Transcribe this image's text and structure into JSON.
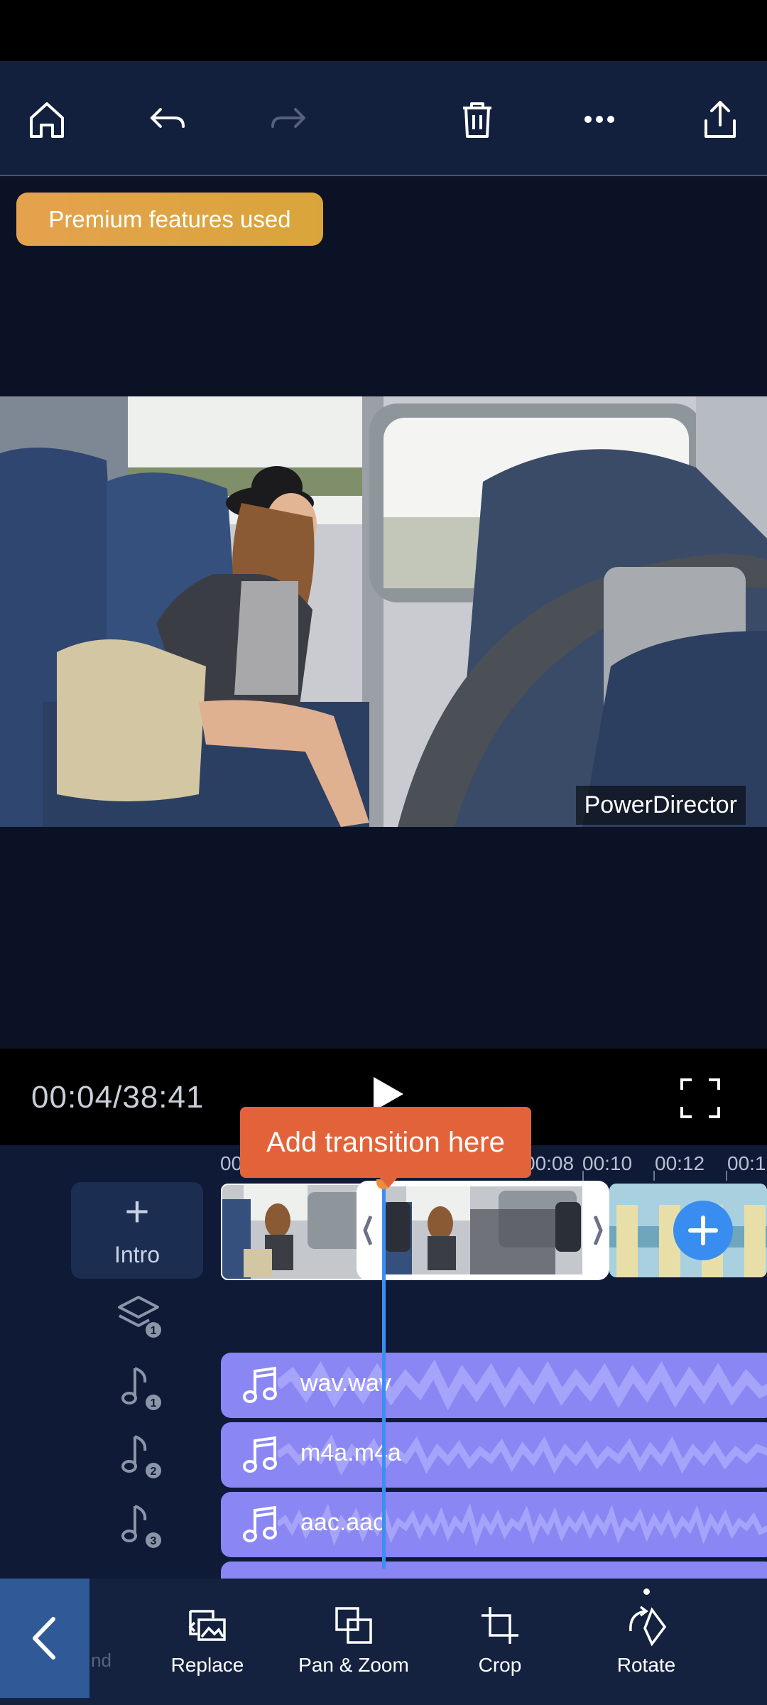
{
  "toolbar": {
    "home_icon": "home-icon",
    "undo_icon": "undo-icon",
    "redo_icon": "redo-icon",
    "delete_icon": "trash-icon",
    "more_icon": "more-icon",
    "share_icon": "share-icon"
  },
  "premium_badge": "Premium features used",
  "preview": {
    "watermark": "PowerDirector"
  },
  "playback": {
    "timecode": "00:04/38:41"
  },
  "timeline": {
    "ruler": [
      "00",
      "00:08",
      "00:10",
      "00:12",
      "00:1"
    ],
    "intro_label": "Intro",
    "tooltip": "Add transition here",
    "audio_tracks": [
      {
        "name": "wav.wav",
        "badge": "1"
      },
      {
        "name": "m4a.m4a",
        "badge": "2"
      },
      {
        "name": "aac.aac",
        "badge": "3"
      }
    ],
    "overlay_badge": "1"
  },
  "bottom_bar": {
    "partial_label": "nd",
    "items": [
      {
        "label": "Replace"
      },
      {
        "label": "Pan & Zoom"
      },
      {
        "label": "Crop"
      },
      {
        "label": "Rotate"
      }
    ]
  },
  "colors": {
    "background": "#0b1226",
    "accent": "#3e8ef0",
    "audio_track": "#8a86f3",
    "tooltip": "#e2633a",
    "premium": "#e5a24e"
  }
}
